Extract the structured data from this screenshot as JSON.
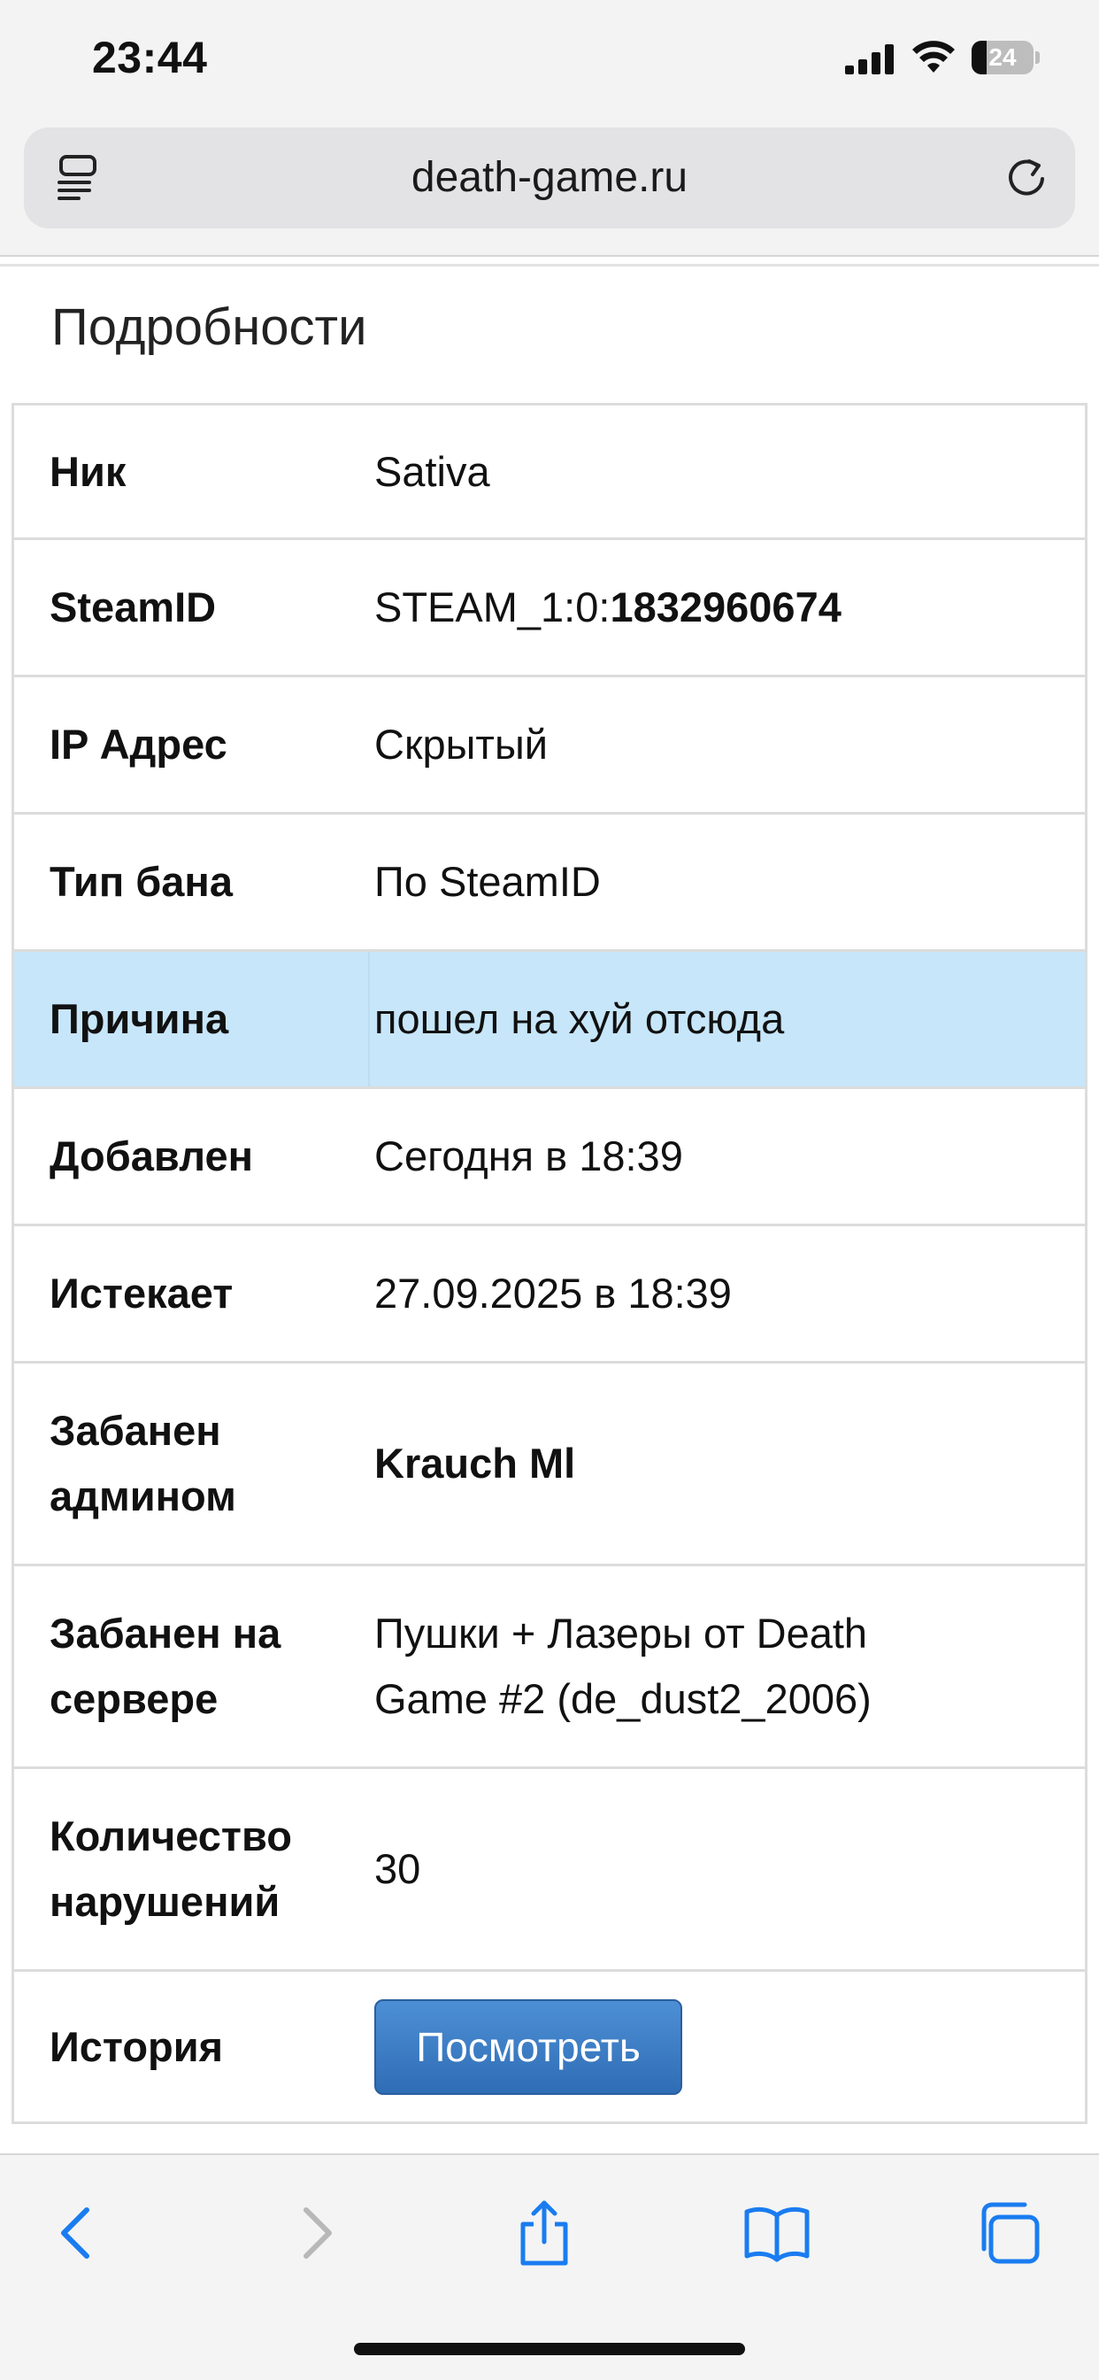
{
  "status_bar": {
    "time": "23:44",
    "battery_level": "24",
    "icons": [
      "cellular-signal-icon",
      "wifi-icon",
      "battery-icon"
    ]
  },
  "browser": {
    "url": "death-game.ru",
    "icons": {
      "left": "reader-icon",
      "right": "reload-icon"
    }
  },
  "section": {
    "title": "Подробности"
  },
  "details": {
    "nick": {
      "label": "Ник",
      "value": "Sativa"
    },
    "steamid": {
      "label": "SteamID",
      "prefix": "STEAM_1:0:",
      "number": "1832960674"
    },
    "ip": {
      "label": "IP Адрес",
      "value": "Скрытый"
    },
    "ban_type": {
      "label": "Тип бана",
      "value": "По SteamID"
    },
    "reason": {
      "label": "Причина",
      "value": "пошел на хуй отсюда"
    },
    "added": {
      "label": "Добавлен",
      "value": "Сегодня в 18:39"
    },
    "expires": {
      "label": "Истекает",
      "value": "27.09.2025 в 18:39"
    },
    "admin": {
      "label_line1": "Забанен",
      "label_line2": "админом",
      "value": "Krauch Ml"
    },
    "server": {
      "label_line1": "Забанен на",
      "label_line2": "сервере",
      "value_line1": "Пушки + Лазеры от Death",
      "value_line2": "Game #2 (de_dust2_2006)"
    },
    "violations": {
      "label_line1": "Количество",
      "label_line2": "нарушений",
      "value": "30"
    },
    "history": {
      "label": "История",
      "button": "Посмотреть"
    }
  },
  "toolbar": {
    "items": [
      "back-icon",
      "forward-icon",
      "share-icon",
      "bookmarks-icon",
      "tabs-icon"
    ]
  },
  "colors": {
    "highlight_row": "#c7e6fa",
    "button_blue": "#3a7cc4",
    "ios_blue": "#1a7cf0",
    "disabled_gray": "#b8b8b8"
  }
}
